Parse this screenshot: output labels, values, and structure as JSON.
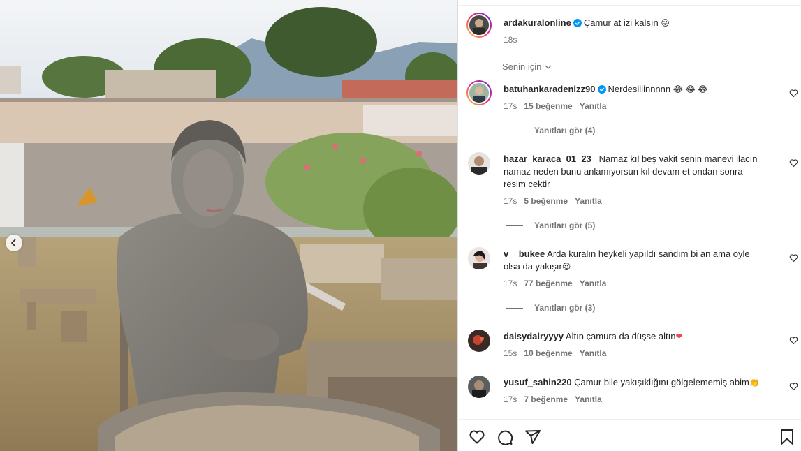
{
  "post": {
    "author": "ardakuralonline",
    "caption": "Çamur at izi kalsın",
    "caption_emoji": "😜",
    "time": "18s"
  },
  "sort_label": "Senin için",
  "comments": [
    {
      "user": "batuhankaradenizz90",
      "verified": true,
      "text": "Nerdesiiiinnnnn",
      "emoji": "😂 😂 😂",
      "time": "17s",
      "likes": "15 beğenme",
      "reply": "Yanıtla",
      "view_replies": "Yanıtları gör (4)"
    },
    {
      "user": "hazar_karaca_01_23_",
      "verified": false,
      "text_lines": [
        "Namaz kıl beş vakit senin manevi ilacın",
        "namaz neden bunu anlamıyorsun kıl devam et ondan sonra",
        "resim cektir"
      ],
      "time": "17s",
      "likes": "5 beğenme",
      "reply": "Yanıtla",
      "view_replies": "Yanıtları gör (5)"
    },
    {
      "user": "v__bukee",
      "verified": false,
      "text_lines": [
        "Arda kuralın heykeli yapıldı sandım bi an ama öyle",
        "olsa da yakışır"
      ],
      "emoji": "😍",
      "time": "17s",
      "likes": "77 beğenme",
      "reply": "Yanıtla",
      "view_replies": "Yanıtları gör (3)"
    },
    {
      "user": "daisydairyyyy",
      "verified": false,
      "text": "Altın çamura da düşse altın",
      "emoji": "❤",
      "time": "15s",
      "likes": "10 beğenme",
      "reply": "Yanıtla"
    },
    {
      "user": "yusuf_sahin220",
      "verified": false,
      "text": "Çamur bile yakışıklığını gölgelememiş abim",
      "emoji": "👏",
      "time": "17s",
      "likes": "7 beğenme",
      "reply": "Yanıtla"
    }
  ],
  "colors": {
    "verified": "#0095f6",
    "meta": "#737373",
    "heart_red": "#ed4956"
  },
  "icons": [
    "heart-icon",
    "comment-icon",
    "share-icon",
    "bookmark-icon",
    "chevron-down-icon",
    "chevron-left-icon"
  ]
}
